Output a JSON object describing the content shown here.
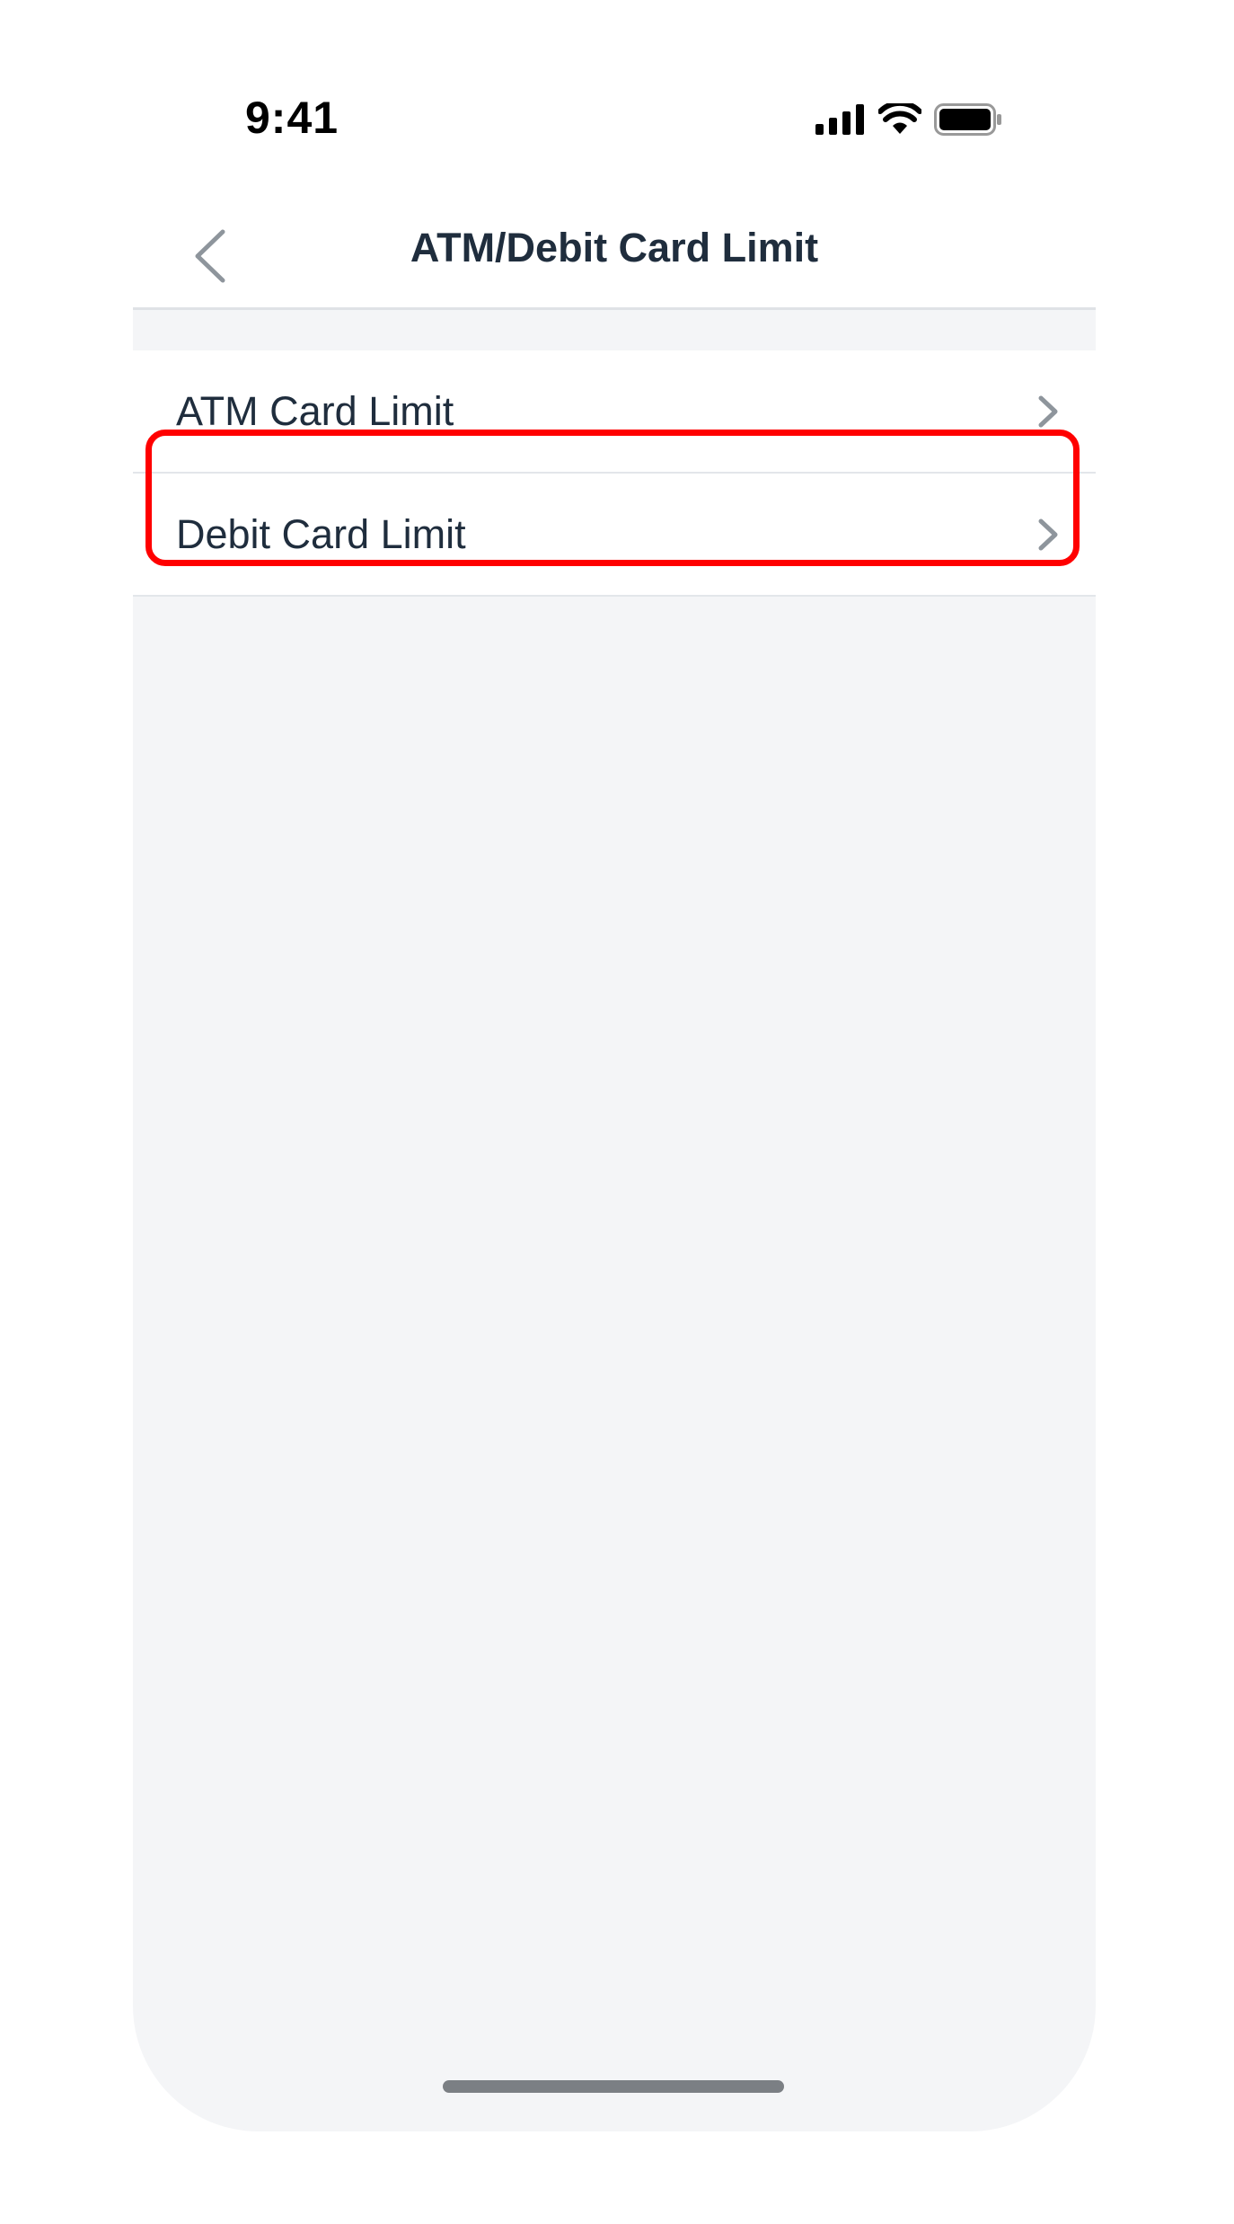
{
  "status_bar": {
    "time": "9:41",
    "icons": [
      "cellular-signal-icon",
      "wifi-icon",
      "battery-icon"
    ]
  },
  "nav": {
    "title": "ATM/Debit Card Limit",
    "back_icon": "chevron-left-icon"
  },
  "list": {
    "items": [
      {
        "label": "ATM Card Limit",
        "icon": "chevron-right-icon"
      },
      {
        "label": "Debit Card Limit",
        "icon": "chevron-right-icon"
      }
    ]
  },
  "colors": {
    "text": "#1f2d3d",
    "background": "#f4f5f7",
    "highlight": "#ff0000",
    "chevron": "#8e959c"
  }
}
